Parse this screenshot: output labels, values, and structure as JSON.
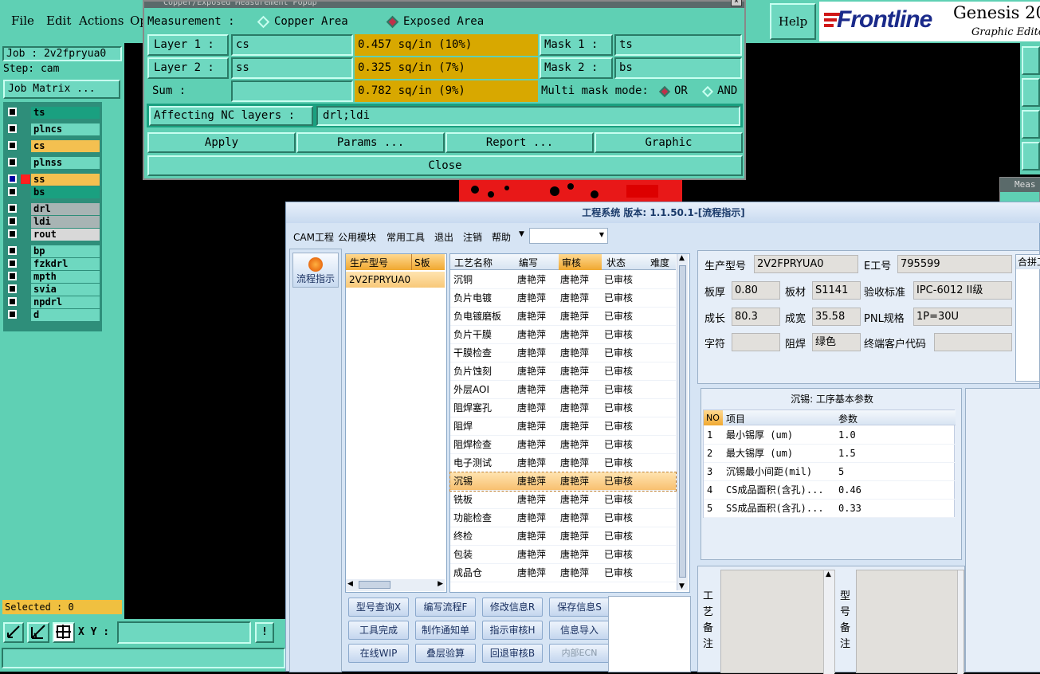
{
  "menu": {
    "file": "File",
    "edit": "Edit",
    "actions": "Actions",
    "op": "Op",
    "help": "Help",
    "logo": "Frontline",
    "product": "Genesis 20",
    "subtitle": "Graphic Editor"
  },
  "left": {
    "job": "Job : 2v2fpryua0",
    "step": "Step: cam",
    "job_matrix": "Job Matrix ...",
    "layers": [
      {
        "name": "ts",
        "color": "#1aa080"
      },
      {
        "name": "plncs",
        "color": "#6ed8c0"
      },
      {
        "name": "cs",
        "color": "#f4c050"
      },
      {
        "name": "plnss",
        "color": "#6ed8c0"
      },
      {
        "name": "ss",
        "color": "#f4c050"
      },
      {
        "name": "bs",
        "color": "#1aa080"
      },
      {
        "name": "drl",
        "color": "#a8b4b4"
      },
      {
        "name": "ldi",
        "color": "#a8b4b4"
      },
      {
        "name": "rout",
        "color": "#d8d8d8"
      },
      {
        "name": "bp",
        "color": "#6ed8c0"
      },
      {
        "name": "fzkdrl",
        "color": "#6ed8c0"
      },
      {
        "name": "mpth",
        "color": "#6ed8c0"
      },
      {
        "name": "svia",
        "color": "#6ed8c0"
      },
      {
        "name": "npdrl",
        "color": "#6ed8c0"
      },
      {
        "name": "d",
        "color": "#6ed8c0"
      }
    ],
    "selected": "Selected : 0",
    "xy_label": "X Y :"
  },
  "popup": {
    "title": "Copper/Exposed Measurement Popup",
    "measurement_label": "Measurement   :",
    "opt_copper": "Copper Area",
    "opt_exposed": "Exposed Area",
    "layer1_label": "Layer 1 :",
    "layer1_value": "cs",
    "layer1_result": "0.457 sq/in (10%)",
    "layer2_label": "Layer 2 :",
    "layer2_value": "ss",
    "layer2_result": "0.325 sq/in (7%)",
    "sum_label": "Sum     :",
    "sum_result": "0.782 sq/in (9%)",
    "mask1_label": "Mask 1 :",
    "mask1_value": "ts",
    "mask2_label": "Mask 2 :",
    "mask2_value": "bs",
    "multimask_label": "Multi mask mode:",
    "opt_or": "OR",
    "opt_and": "AND",
    "nc_label": "Affecting NC layers :",
    "nc_value": "drl;ldi",
    "apply": "Apply",
    "params": "Params ...",
    "report": "Report ...",
    "graphic": "Graphic",
    "close": "Close"
  },
  "side_window_title": "Meas",
  "cn": {
    "title": "工程系统 版本: 1.1.50.1-[流程指示]",
    "menu": [
      "CAM工程",
      "公用模块",
      "常用工具",
      "退出",
      "注销",
      "帮助"
    ],
    "flow_btn": "流程指示",
    "model_grid": {
      "headers": [
        "生产型号",
        "S板"
      ],
      "rows": [
        "2V2FPRYUA0"
      ]
    },
    "process_grid": {
      "headers": [
        "工艺名称",
        "编写",
        "审核",
        "状态",
        "难度"
      ],
      "rows": [
        [
          "沉铜",
          "唐艳萍",
          "唐艳萍",
          "已审核"
        ],
        [
          "负片电镀",
          "唐艳萍",
          "唐艳萍",
          "已审核"
        ],
        [
          "负电镀磨板",
          "唐艳萍",
          "唐艳萍",
          "已审核"
        ],
        [
          "负片干膜",
          "唐艳萍",
          "唐艳萍",
          "已审核"
        ],
        [
          "干膜检查",
          "唐艳萍",
          "唐艳萍",
          "已审核"
        ],
        [
          "负片蚀刻",
          "唐艳萍",
          "唐艳萍",
          "已审核"
        ],
        [
          "外层AOI",
          "唐艳萍",
          "唐艳萍",
          "已审核"
        ],
        [
          "阻焊塞孔",
          "唐艳萍",
          "唐艳萍",
          "已审核"
        ],
        [
          "阻焊",
          "唐艳萍",
          "唐艳萍",
          "已审核"
        ],
        [
          "阻焊检查",
          "唐艳萍",
          "唐艳萍",
          "已审核"
        ],
        [
          "电子测试",
          "唐艳萍",
          "唐艳萍",
          "已审核"
        ],
        [
          "沉锡",
          "唐艳萍",
          "唐艳萍",
          "已审核"
        ],
        [
          "铣板",
          "唐艳萍",
          "唐艳萍",
          "已审核"
        ],
        [
          "功能检查",
          "唐艳萍",
          "唐艳萍",
          "已审核"
        ],
        [
          "终检",
          "唐艳萍",
          "唐艳萍",
          "已审核"
        ],
        [
          "包装",
          "唐艳萍",
          "唐艳萍",
          "已审核"
        ],
        [
          "成品仓",
          "唐艳萍",
          "唐艳萍",
          "已审核"
        ]
      ],
      "selected_index": 11
    },
    "buttons": [
      [
        "型号查询X",
        "编写流程F",
        "修改信息R",
        "保存信息S"
      ],
      [
        "工具完成",
        "制作通知单",
        "指示审核H",
        "信息导入"
      ],
      [
        "在线WIP",
        "叠层验算",
        "回退审核B",
        "内部ECN"
      ]
    ],
    "info": {
      "model_label": "生产型号",
      "model_value": "2V2FPRYUA0",
      "eno_label": "E工号",
      "eno_value": "795599",
      "merge_label": "合拼工",
      "thick_label": "板厚",
      "thick_value": "0.80",
      "material_label": "板材",
      "material_value": "S1141",
      "std_label": "验收标准",
      "std_value": "IPC-6012 II级",
      "len_label": "成长",
      "len_value": "80.3",
      "width_label": "成宽",
      "width_value": "35.58",
      "pnl_label": "PNL规格",
      "pnl_value": "1P=30U",
      "char_label": "字符",
      "char_value": "",
      "mask_label": "阻焊",
      "mask_value": "绿色",
      "cust_label": "终端客户代码",
      "cust_value": ""
    },
    "params": {
      "title": "沉锡: 工序基本参数",
      "headers": [
        "NO",
        "项目",
        "参数"
      ],
      "rows": [
        [
          "1",
          "最小锡厚 (um)",
          "1.0"
        ],
        [
          "2",
          "最大锡厚 (um)",
          "1.5"
        ],
        [
          "3",
          "沉锡最小间距(mil)",
          "5"
        ],
        [
          "4",
          "CS成品面积(含孔)...",
          "0.46"
        ],
        [
          "5",
          "SS成品面积(含孔)...",
          "0.33"
        ]
      ]
    },
    "remark1": "工艺备注",
    "remark2": "型号备注"
  }
}
